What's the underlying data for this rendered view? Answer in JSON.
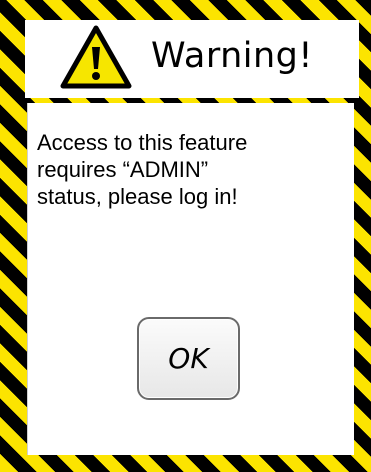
{
  "dialog": {
    "title": "Warning!",
    "icon": "warning-triangle-icon",
    "message_lines": [
      "Access to this feature",
      "requires “ADMIN”",
      "status, please log in!"
    ],
    "ok_label": "OK",
    "colors": {
      "stripe_yellow": "#fce400",
      "stripe_black": "#000000",
      "icon_yellow": "#f6e600",
      "panel": "#ffffff"
    }
  }
}
